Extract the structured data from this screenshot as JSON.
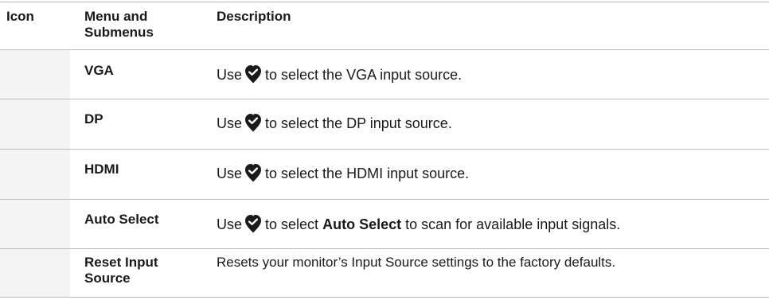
{
  "header": {
    "icon": "Icon",
    "menu": "Menu and Submenus",
    "description": "Description"
  },
  "rows": [
    {
      "menu": "VGA",
      "pre": "Use",
      "icon": "check-icon",
      "post": "to select the VGA input source."
    },
    {
      "menu": "DP",
      "pre": "Use",
      "icon": "check-icon",
      "post": "to select the DP input source."
    },
    {
      "menu": "HDMI",
      "pre": "Use",
      "icon": "check-icon",
      "post": "to select the HDMI input source."
    },
    {
      "menu": "Auto Select",
      "pre": "Use",
      "icon": "check-icon",
      "mid": "to select",
      "bold": "Auto Select",
      "post": "to scan for available input signals."
    },
    {
      "menu": "Reset Input Source",
      "desc": "Resets your monitor’s Input Source settings to the factory defaults."
    }
  ]
}
